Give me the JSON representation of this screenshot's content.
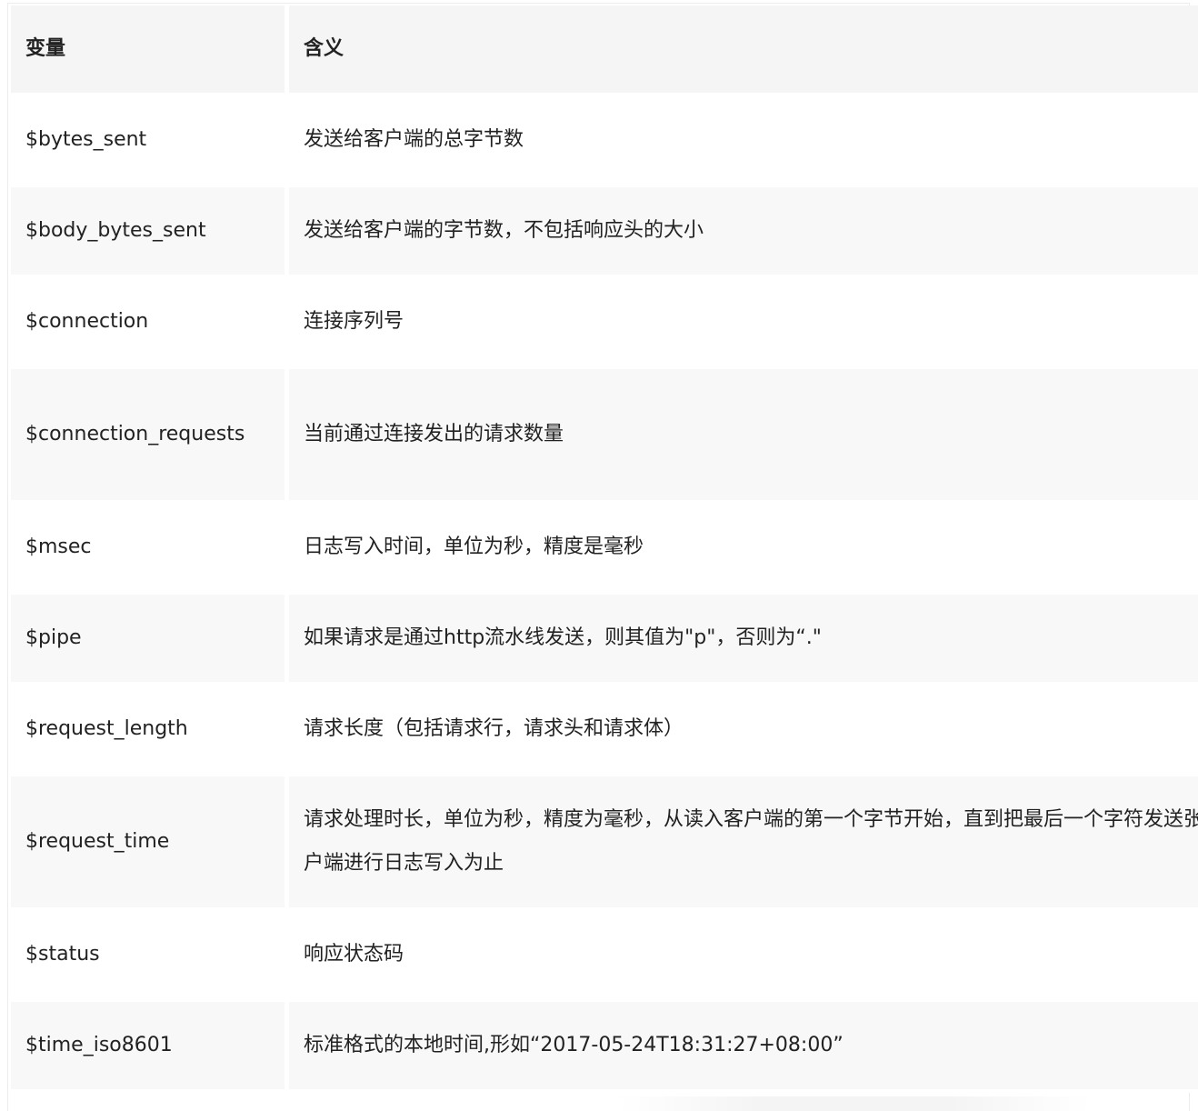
{
  "table": {
    "headers": [
      "变量",
      "含义"
    ],
    "rows": [
      [
        "$bytes_sent",
        "发送给客户端的总字节数"
      ],
      [
        "$body_bytes_sent",
        "发送给客户端的字节数，不包括响应头的大小"
      ],
      [
        "$connection",
        "连接序列号"
      ],
      [
        "$connection_requests",
        "当前通过连接发出的请求数量"
      ],
      [
        "$msec",
        "日志写入时间，单位为秒，精度是毫秒"
      ],
      [
        "$pipe",
        "如果请求是通过http流水线发送，则其值为\"p\"，否则为“.\""
      ],
      [
        "$request_length",
        "请求长度（包括请求行，请求头和请求体）"
      ],
      [
        "$request_time",
        "请求处理时长，单位为秒，精度为毫秒，从读入客户端的第一个字节开始，直到把最后一个字符发送张客户端进行日志写入为止"
      ],
      [
        "$status",
        "响应状态码"
      ],
      [
        "$time_iso8601",
        "标准格式的本地时间,形如“2017-05-24T18:31:27+08:00”"
      ]
    ]
  }
}
